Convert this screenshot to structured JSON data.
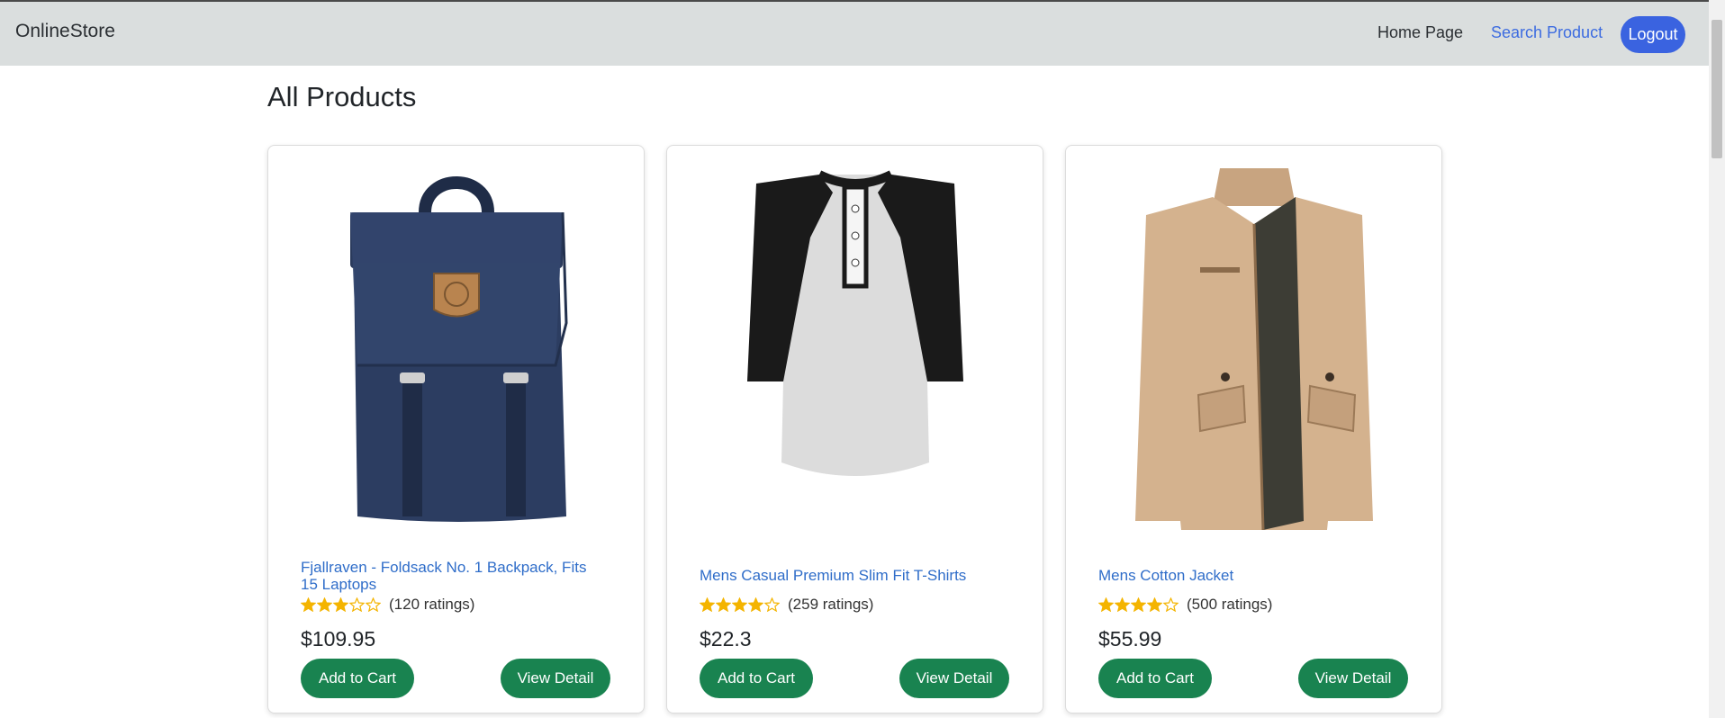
{
  "navbar": {
    "brand": "OnlineStore",
    "home_label": "Home Page",
    "search_label": "Search Product",
    "logout_label": "Logout"
  },
  "page": {
    "title": "All Products"
  },
  "products": [
    {
      "title": "Fjallraven - Foldsack No. 1 Backpack, Fits 15 Laptops",
      "rating_text": "(120 ratings)",
      "stars_filled": 3,
      "price": "$109.95",
      "add_to_cart_label": "Add to Cart",
      "view_detail_label": "View Detail",
      "image_icon": "backpack-icon"
    },
    {
      "title": "Mens Casual Premium Slim Fit T-Shirts",
      "rating_text": "(259 ratings)",
      "stars_filled": 4,
      "price": "$22.3",
      "add_to_cart_label": "Add to Cart",
      "view_detail_label": "View Detail",
      "image_icon": "tshirt-icon"
    },
    {
      "title": "Mens Cotton Jacket",
      "rating_text": "(500 ratings)",
      "stars_filled": 4,
      "price": "$55.99",
      "add_to_cart_label": "Add to Cart",
      "view_detail_label": "View Detail",
      "image_icon": "jacket-icon"
    }
  ],
  "colors": {
    "navbar_bg": "#dadede",
    "primary_blue": "#3a63e0",
    "link_blue": "#2f6dc9",
    "button_green": "#198350",
    "star_gold": "#f4b400"
  }
}
